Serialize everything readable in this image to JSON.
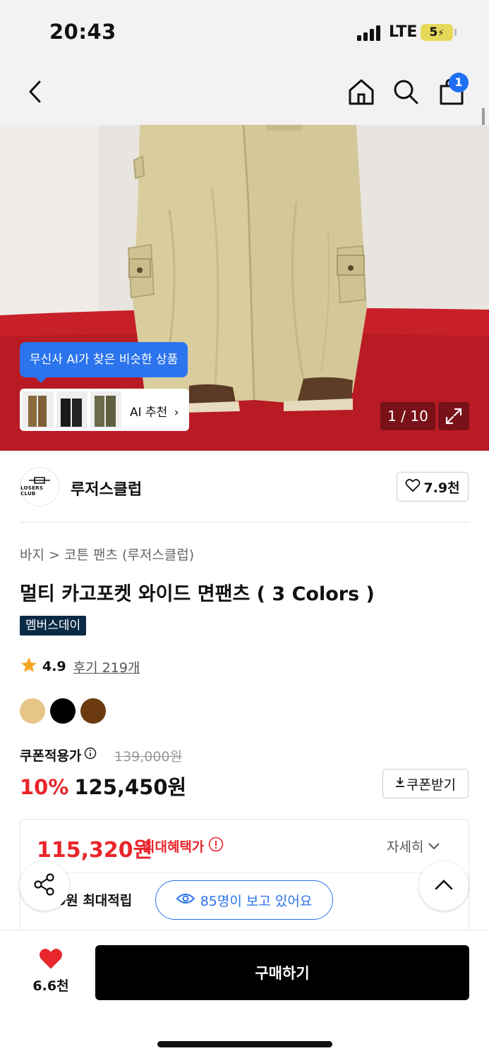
{
  "status_bar": {
    "time": "20:43",
    "network": "LTE",
    "battery": "5"
  },
  "nav": {
    "cart_count": "1"
  },
  "hero": {
    "ai_tooltip": "무신사 AI가 찾은 비슷한 상품",
    "ai_card_label": "AI 추천",
    "image_counter": "1 / 10"
  },
  "brand": {
    "name": "루저스클럽",
    "logo_text": "LOSERS CLUB",
    "likes": "7.9천"
  },
  "product": {
    "breadcrumb": "바지 > 코튼 팬츠 (루저스클럽)",
    "title": "멀티 카고포켓 와이드 면팬츠 ( 3 Colors )",
    "badge": "멤버스데이",
    "rating": "4.9",
    "review_text": "후기 219개",
    "swatches": [
      "#e6c588",
      "#000000",
      "#6b3a0f"
    ]
  },
  "price": {
    "coupon_label": "쿠폰적용가",
    "original": "139,000원",
    "discount": "10%",
    "final": "125,450원",
    "coupon_button": "쿠폰받기"
  },
  "benefit": {
    "max_price": "115,320원",
    "max_label": "최대혜택가",
    "detail": "자세히",
    "points": "0원 최대적립",
    "viewers": "85명이 보고 있어요"
  },
  "bottom": {
    "wish_count": "6.6천",
    "buy_label": "구매하기"
  },
  "colors": {
    "accent_blue": "#2b74ee",
    "price_red": "#e8262c",
    "badge_navy": "#0b2a45"
  }
}
